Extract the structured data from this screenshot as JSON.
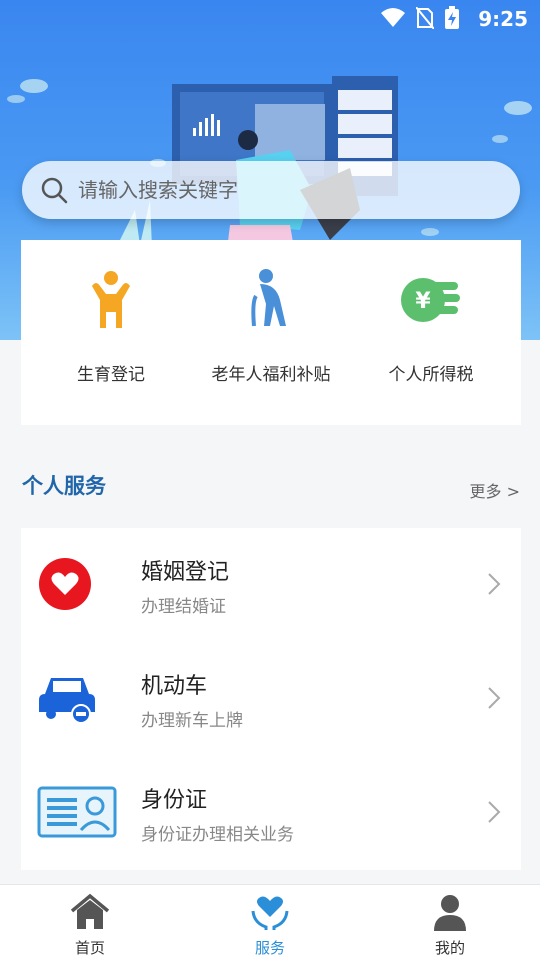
{
  "status": {
    "time": "9:25"
  },
  "search": {
    "placeholder": "请输入搜索关键字"
  },
  "quick_services": [
    {
      "label": "生育登记",
      "icon": "person-raising-arms-icon",
      "color": "#f5a623"
    },
    {
      "label": "老年人福利补贴",
      "icon": "elderly-person-cane-icon",
      "color": "#4a90d9"
    },
    {
      "label": "个人所得税",
      "icon": "yuan-coins-icon",
      "color": "#5bbf6e"
    }
  ],
  "section": {
    "title": "个人服务",
    "more": "更多 >"
  },
  "services": [
    {
      "title": "婚姻登记",
      "subtitle": "办理结婚证",
      "icon": "heart-icon",
      "color": "#e8161e"
    },
    {
      "title": "机动车",
      "subtitle": "办理新车上牌",
      "icon": "car-icon",
      "color": "#1a63d8"
    },
    {
      "title": "身份证",
      "subtitle": "身份证办理相关业务",
      "icon": "id-card-icon",
      "color": "#3a9ad9"
    }
  ],
  "tabs": [
    {
      "label": "首页",
      "icon": "home-icon",
      "active": false
    },
    {
      "label": "服务",
      "icon": "service-heart-icon",
      "active": true
    },
    {
      "label": "我的",
      "icon": "user-icon",
      "active": false
    }
  ],
  "colors": {
    "accent": "#2a8fd8",
    "section_title": "#2266aa"
  }
}
